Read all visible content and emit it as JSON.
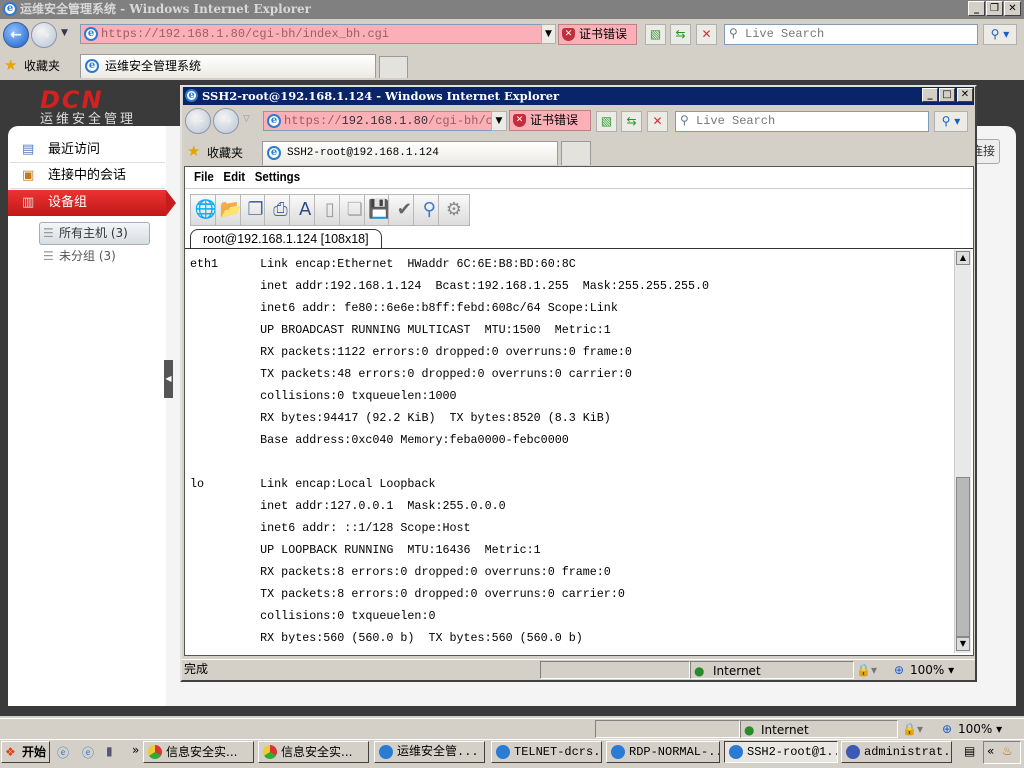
{
  "outer_window": {
    "title": "运维安全管理系统 - Windows Internet Explorer",
    "address": "https://192.168.1.80/cgi-bh/index_bh.cgi",
    "cert_error": "证书错误",
    "search_placeholder": "Live Search",
    "favorites": "收藏夹",
    "tab_title": "运维安全管理系统",
    "status_zone": "Internet",
    "zoom": "100%"
  },
  "app": {
    "logo": "DCN",
    "logo_sub": "运维安全管理",
    "sidebar": [
      {
        "label": "最近访问",
        "icon": "recent-icon"
      },
      {
        "label": "连接中的会话",
        "icon": "session-icon"
      },
      {
        "label": "设备组",
        "icon": "device-group-icon",
        "active": true
      }
    ],
    "tree": [
      {
        "label": "所有主机 (3)",
        "selected": true
      },
      {
        "label": "未分组 (3)"
      }
    ],
    "right_button": "连接",
    "accent": "#d42020"
  },
  "popup": {
    "title": "SSH2-root@192.168.1.124 - Windows Internet Explorer",
    "address_prefix": "https://",
    "address_host": "192.168.1.80",
    "address_rest": "/cgi-bh/contro",
    "cert_error": "证书错误",
    "search_placeholder": "Live Search",
    "favorites": "收藏夹",
    "tab_title": "SSH2-root@192.168.1.124",
    "menu": [
      "File",
      "Edit",
      "Settings"
    ],
    "toolbar_icons": [
      "connect-globe-icon",
      "open-folder-icon",
      "copy-screen-icon",
      "print-icon",
      "font-icon",
      "blank-page-icon",
      "copy-page-icon",
      "save-icon",
      "check-icon",
      "find-icon",
      "settings-gears-icon"
    ],
    "session_tab": "root@192.168.1.124 [108x18]",
    "terminal_lines": [
      "eth1      Link encap:Ethernet  HWaddr 6C:6E:B8:BD:60:8C",
      "          inet addr:192.168.1.124  Bcast:192.168.1.255  Mask:255.255.255.0",
      "          inet6 addr: fe80::6e6e:b8ff:febd:608c/64 Scope:Link",
      "          UP BROADCAST RUNNING MULTICAST  MTU:1500  Metric:1",
      "          RX packets:1122 errors:0 dropped:0 overruns:0 frame:0",
      "          TX packets:48 errors:0 dropped:0 overruns:0 carrier:0",
      "          collisions:0 txqueuelen:1000",
      "          RX bytes:94417 (92.2 KiB)  TX bytes:8520 (8.3 KiB)",
      "          Base address:0xc040 Memory:feba0000-febc0000",
      "",
      "lo        Link encap:Local Loopback",
      "          inet addr:127.0.0.1  Mask:255.0.0.0",
      "          inet6 addr: ::1/128 Scope:Host",
      "          UP LOOPBACK RUNNING  MTU:16436  Metric:1",
      "          RX packets:8 errors:0 dropped:0 overruns:0 frame:0",
      "          TX packets:8 errors:0 dropped:0 overruns:0 carrier:0",
      "          collisions:0 txqueuelen:0",
      "          RX bytes:560 (560.0 b)  TX bytes:560 (560.0 b)"
    ],
    "status": "完成",
    "status_zone": "Internet",
    "zoom": "100%"
  },
  "taskbar": {
    "start": "开始",
    "items": [
      {
        "label": "信息安全实...",
        "icon": "chrome-icon"
      },
      {
        "label": "信息安全实...",
        "icon": "chrome-icon"
      },
      {
        "label": "运维安全管...",
        "icon": "ie-icon"
      },
      {
        "label": "TELNET-dcrs...",
        "icon": "ie-icon"
      },
      {
        "label": "RDP-NORMAL-...",
        "icon": "ie-icon"
      },
      {
        "label": "SSH2-root@1...",
        "icon": "ie-icon",
        "active": true
      },
      {
        "label": "administrat...",
        "icon": "admin-icon"
      }
    ]
  }
}
